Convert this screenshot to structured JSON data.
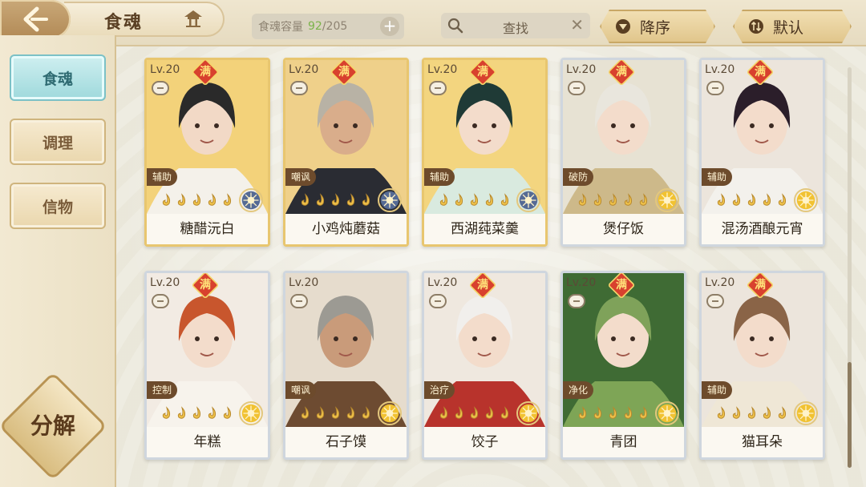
{
  "header": {
    "title": "食魂",
    "capacity_label": "食魂容量",
    "capacity_current": "92",
    "capacity_total": "/205",
    "search_label": "查找",
    "sort_order_label": "降序",
    "sort_mode_label": "默认"
  },
  "sidebar": {
    "items": [
      {
        "label": "食魂",
        "active": true
      },
      {
        "label": "调理",
        "active": false
      },
      {
        "label": "信物",
        "active": false
      }
    ],
    "decompose_label": "分解"
  },
  "cards": [
    {
      "level": "Lv.20",
      "full": "满",
      "role": "辅助",
      "name": "糖醋沅白",
      "frame": "gold",
      "bg": "#f3d27a",
      "hair": "#2a2a2a",
      "skin": "#f2d9c6",
      "cloth": "#f4f1ea",
      "emblem": "#556a94"
    },
    {
      "level": "Lv.20",
      "full": "满",
      "role": "嘲讽",
      "name": "小鸡炖蘑菇",
      "frame": "gold",
      "bg": "#efd08a",
      "hair": "#b8b2a5",
      "skin": "#d9ad8b",
      "cloth": "#2a2c33",
      "emblem": "#556a94"
    },
    {
      "level": "Lv.20",
      "full": "满",
      "role": "辅助",
      "name": "西湖莼菜羹",
      "frame": "gold",
      "bg": "#f3d57f",
      "hair": "#1f3a36",
      "skin": "#f3dccb",
      "cloth": "#d9eadf",
      "emblem": "#556a94"
    },
    {
      "level": "Lv.20",
      "full": "满",
      "role": "破防",
      "name": "煲仔饭",
      "frame": "silver",
      "bg": "#e7e2d3",
      "hair": "#e9e6dd",
      "skin": "#f3dccb",
      "cloth": "#cdb98a",
      "emblem": "#f1c232"
    },
    {
      "level": "Lv.20",
      "full": "满",
      "role": "辅助",
      "name": "混汤酒酿元宵",
      "frame": "silver",
      "bg": "#ece5dc",
      "hair": "#2b1e2a",
      "skin": "#f3dccb",
      "cloth": "#f3f1ec",
      "emblem": "#f1c232"
    },
    {
      "level": "Lv.20",
      "full": "满",
      "role": "控制",
      "name": "年糕",
      "frame": "silver",
      "bg": "#f2ebe3",
      "hair": "#c8562d",
      "skin": "#f3dccb",
      "cloth": "#f7f3ec",
      "emblem": "#f1c232"
    },
    {
      "level": "Lv.20",
      "full": "",
      "role": "嘲讽",
      "name": "石子馍",
      "frame": "silver",
      "bg": "#e6dccd",
      "hair": "#9c9a93",
      "skin": "#c99b7a",
      "cloth": "#6d4b31",
      "emblem": "#f1c232"
    },
    {
      "level": "Lv.20",
      "full": "满",
      "role": "治疗",
      "name": "饺子",
      "frame": "silver",
      "bg": "#efe8df",
      "hair": "#f1efec",
      "skin": "#f3dccb",
      "cloth": "#b8332c",
      "emblem": "#f1c232"
    },
    {
      "level": "Lv.20",
      "full": "满",
      "role": "净化",
      "name": "青团",
      "frame": "silver",
      "bg": "#3f6b34",
      "hair": "#7fa25a",
      "skin": "#f3dccb",
      "cloth": "#7ea556",
      "emblem": "#f1c232"
    },
    {
      "level": "Lv.20",
      "full": "满",
      "role": "辅助",
      "name": "猫耳朵",
      "frame": "silver",
      "bg": "#ece5dc",
      "hair": "#8a6447",
      "skin": "#f3dccb",
      "cloth": "#efe7d6",
      "emblem": "#f1c232"
    }
  ],
  "colors": {
    "accent_gold": "#e8c66f",
    "active_tab": "#9ed9dc",
    "capacity_current": "#7bb34a"
  }
}
